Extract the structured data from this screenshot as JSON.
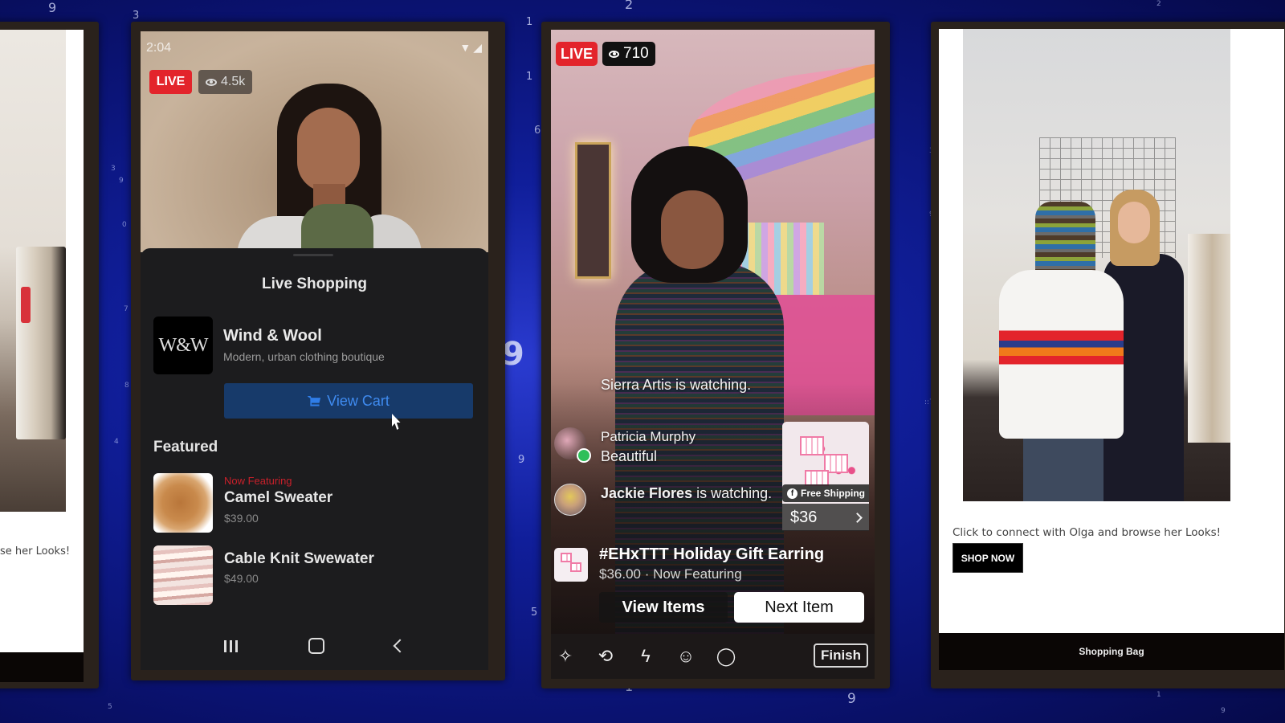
{
  "background": {
    "digits": [
      "9",
      "3",
      "1",
      "2",
      "1",
      "6",
      "9",
      "4",
      "9",
      "5",
      "1",
      "8",
      "9",
      "7",
      "3",
      "9",
      "0",
      "::7568",
      "3",
      "9",
      "8",
      "1",
      "9",
      "2",
      "5",
      "4"
    ]
  },
  "left_panel": {
    "caption": "se her Looks!"
  },
  "phone1": {
    "status_time": "2:04",
    "status_icons": "wifi-icon signal-icon",
    "live_label": "LIVE",
    "viewer_count": "4.5k",
    "sheet_title": "Live Shopping",
    "store": {
      "logo_text": "W&W",
      "name": "Wind & Wool",
      "description": "Modern, urban clothing boutique"
    },
    "view_cart_label": "View Cart",
    "featured_heading": "Featured",
    "products": [
      {
        "tag": "Now Featuring",
        "name": "Camel Sweater",
        "price": "$39.00"
      },
      {
        "tag": "",
        "name": "Cable Knit Swewater",
        "price": "$49.00"
      }
    ],
    "navbar": [
      "recents-icon",
      "home-icon",
      "back-icon"
    ]
  },
  "phone2": {
    "live_label": "LIVE",
    "viewer_count": "710",
    "comments": [
      {
        "name": "Sierra Artis",
        "text": "is watching."
      },
      {
        "name": "Patricia Murphy",
        "text": "Beautiful"
      },
      {
        "name": "Jackie Flores",
        "text": "is watching."
      }
    ],
    "product_card": {
      "badge": "Free Shipping",
      "price": "$36"
    },
    "featured": {
      "title": "#EHxTTT Holiday Gift Earring",
      "subtitle": "$36.00 · Now Featuring"
    },
    "view_items_label": "View Items",
    "next_item_label": "Next Item",
    "toolbar": [
      "magic-wand-icon",
      "flip-camera-icon",
      "flash-off-icon",
      "guest-icon",
      "comment-icon"
    ],
    "finish_label": "Finish",
    "colors": {
      "live": "#e3242b"
    }
  },
  "right_panel": {
    "caption": "Click to connect with Olga and browse her Looks!",
    "shop_now_label": "SHOP NOW",
    "bottom_bar_label": "Shopping Bag"
  }
}
